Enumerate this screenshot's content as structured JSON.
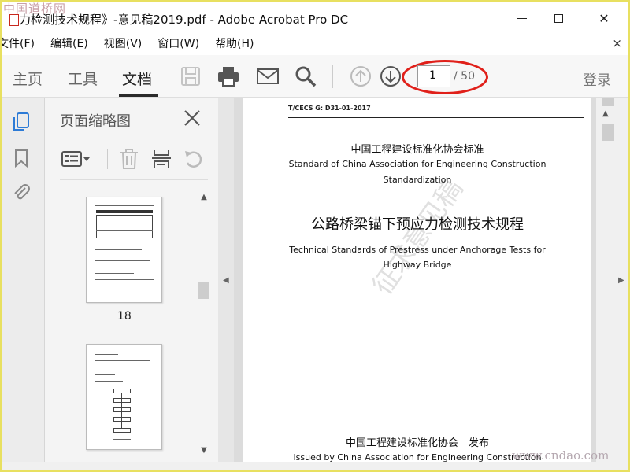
{
  "site_watermark": "中国道桥网",
  "site_watermark_bottom": "www.cndao.com",
  "window": {
    "title": "力检测技术规程》-意见稿2019.pdf - Adobe Acrobat Pro DC",
    "close_symbol": "✕"
  },
  "menu": {
    "items": [
      "文件(F)",
      "编辑(E)",
      "视图(V)",
      "窗口(W)",
      "帮助(H)"
    ],
    "close_symbol": "×"
  },
  "toolbar": {
    "tabs": [
      "主页",
      "工具",
      "文档"
    ],
    "active_tab": "文档",
    "icons": [
      "save-icon",
      "print-icon",
      "mail-icon",
      "search-icon",
      "page-up-icon",
      "page-down-icon"
    ],
    "current_page": "1",
    "total_pages": "/ 50",
    "login_label": "登录",
    "highlight_color": "#e0201a"
  },
  "rail": {
    "icons": [
      "page-thumbnails-icon",
      "bookmark-icon",
      "attachment-icon"
    ],
    "accent": "#2d7bd6"
  },
  "panel": {
    "title": "页面缩略图",
    "thumbnails": [
      {
        "label": "18"
      },
      {
        "label": ""
      }
    ]
  },
  "document": {
    "standard_code": "T/CECS G: D31-01-2017",
    "org_cn": "中国工程建设标准化协会标准",
    "org_en_line1": "Standard of China Association for Engineering Construction",
    "org_en_line2": "Standardization",
    "title_cn": "公路桥梁锚下预应力检测技术规程",
    "title_en_line1": "Technical Standards of Prestress under Anchorage Tests for",
    "title_en_line2": "Highway Bridge",
    "watermark": "征求意见稿",
    "publisher_cn": "中国工程建设标准化协会　发布",
    "publisher_en": "Issued by China Association for Engineering Construction"
  }
}
